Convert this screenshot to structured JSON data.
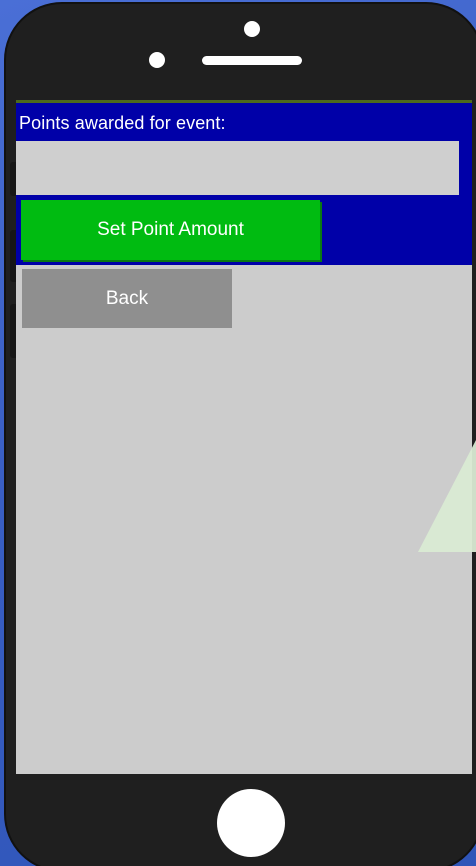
{
  "screen": {
    "prompt_label": "Points awarded for event:",
    "points_input_value": "",
    "points_input_placeholder": "",
    "set_button_label": "Set Point Amount",
    "back_button_label": "Back"
  },
  "colors": {
    "panel_blue": "#0000a8",
    "button_green": "#00bb11",
    "button_gray": "#8f8f8f",
    "screen_background": "#cccccc",
    "device_body": "#1f1f1f",
    "page_background": "#3f63c7"
  },
  "icons": {
    "camera": "camera-dot",
    "speaker": "speaker-grille",
    "home": "home-button"
  }
}
